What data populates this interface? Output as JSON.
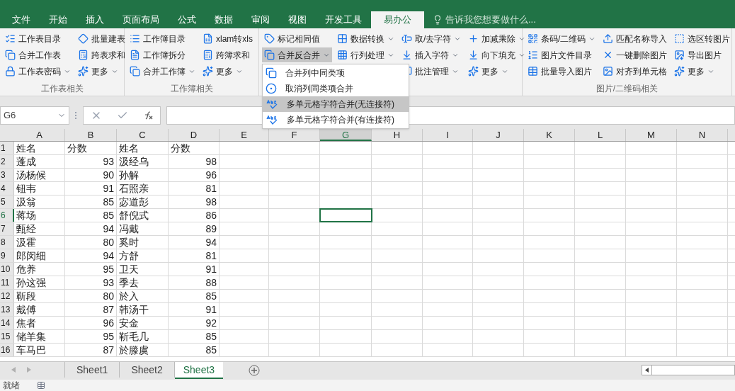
{
  "ribbon_tabs": [
    {
      "label": "文件",
      "selected": false
    },
    {
      "label": "开始",
      "selected": false
    },
    {
      "label": "插入",
      "selected": false
    },
    {
      "label": "页面布局",
      "selected": false
    },
    {
      "label": "公式",
      "selected": false
    },
    {
      "label": "数据",
      "selected": false
    },
    {
      "label": "审阅",
      "selected": false
    },
    {
      "label": "视图",
      "selected": false
    },
    {
      "label": "开发工具",
      "selected": false
    },
    {
      "label": "易办公",
      "selected": true
    }
  ],
  "tell_me": {
    "placeholder": "告诉我您想要做什么..."
  },
  "ribbon_groups": [
    {
      "label": "工作表相关",
      "columns": [
        [
          {
            "label": "工作表目录",
            "dropdown": false
          },
          {
            "label": "合并工作表",
            "dropdown": false
          },
          {
            "label": "工作表密码",
            "dropdown": true
          }
        ],
        [
          {
            "label": "批量建表",
            "dropdown": false
          },
          {
            "label": "跨表求和",
            "dropdown": false
          },
          {
            "label": "更多",
            "dropdown": true
          }
        ]
      ]
    },
    {
      "label": "工作簿相关",
      "columns": [
        [
          {
            "label": "工作簿目录",
            "dropdown": false
          },
          {
            "label": "工作簿拆分",
            "dropdown": false
          },
          {
            "label": "合并工作簿",
            "dropdown": true
          }
        ],
        [
          {
            "label": "xlam转xls",
            "dropdown": false
          },
          {
            "label": "跨簿求和",
            "dropdown": false
          },
          {
            "label": "更多",
            "dropdown": true
          }
        ]
      ]
    },
    {
      "columns": [
        [
          {
            "label": "标记相同值",
            "dropdown": false
          },
          {
            "label": "合并反合并",
            "dropdown": true,
            "pressed": true
          }
        ],
        [
          {
            "label": "数据转换",
            "dropdown": true
          },
          {
            "label": "行列处理",
            "dropdown": true
          }
        ],
        [
          {
            "label": "取/去字符",
            "dropdown": true
          },
          {
            "label": "插入字符",
            "dropdown": true
          },
          {
            "label": "批注管理",
            "dropdown": true
          }
        ],
        [
          {
            "label": "加减乘除",
            "dropdown": true
          },
          {
            "label": "向下填充",
            "dropdown": true
          },
          {
            "label": "更多",
            "dropdown": true
          }
        ]
      ]
    },
    {
      "label": "图片/二维码相关",
      "columns": [
        [
          {
            "label": "条码/二维码",
            "dropdown": true
          },
          {
            "label": "图片文件目录",
            "dropdown": false
          },
          {
            "label": "批量导入图片",
            "dropdown": false
          }
        ],
        [
          {
            "label": "匹配名称导入",
            "dropdown": false
          },
          {
            "label": "一键删除图片",
            "dropdown": false
          },
          {
            "label": "对齐到单元格",
            "dropdown": false
          }
        ],
        [
          {
            "label": "选区转图片",
            "dropdown": false
          },
          {
            "label": "导出图片",
            "dropdown": false
          },
          {
            "label": "更多",
            "dropdown": true
          }
        ]
      ]
    }
  ],
  "dropdown_menu": [
    {
      "label": "合并列中同类项",
      "selected": false
    },
    {
      "label": "取消列同类项合并",
      "selected": false
    },
    {
      "label": "多单元格字符合并(无连接符)",
      "selected": true
    },
    {
      "label": "多单元格字符合并(有连接符)",
      "selected": false
    }
  ],
  "name_box": "G6",
  "columns": [
    {
      "label": "A",
      "selected": false
    },
    {
      "label": "B",
      "selected": false
    },
    {
      "label": "C",
      "selected": false
    },
    {
      "label": "D",
      "selected": false
    },
    {
      "label": "E",
      "selected": false
    },
    {
      "label": "F",
      "selected": false
    },
    {
      "label": "G",
      "selected": true
    },
    {
      "label": "H",
      "selected": false
    },
    {
      "label": "I",
      "selected": false
    },
    {
      "label": "J",
      "selected": false
    },
    {
      "label": "K",
      "selected": false
    },
    {
      "label": "L",
      "selected": false
    },
    {
      "label": "M",
      "selected": false
    },
    {
      "label": "N",
      "selected": false
    }
  ],
  "rows": [
    {
      "number": "1",
      "selected": false,
      "cells": [
        "姓名",
        "分数",
        "姓名",
        "分数"
      ]
    },
    {
      "number": "2",
      "selected": false,
      "cells": [
        "蓬成",
        "93",
        "汲经乌",
        "98"
      ]
    },
    {
      "number": "3",
      "selected": false,
      "cells": [
        "汤杨候",
        "90",
        "孙解",
        "96"
      ]
    },
    {
      "number": "4",
      "selected": false,
      "cells": [
        "钮韦",
        "91",
        "石照亲",
        "81"
      ]
    },
    {
      "number": "5",
      "selected": false,
      "cells": [
        "汲翁",
        "85",
        "宓道彭",
        "98"
      ]
    },
    {
      "number": "6",
      "selected": true,
      "cells": [
        "蒋场",
        "85",
        "舒倪式",
        "86"
      ]
    },
    {
      "number": "7",
      "selected": false,
      "cells": [
        "甄经",
        "94",
        "冯戴",
        "89"
      ]
    },
    {
      "number": "8",
      "selected": false,
      "cells": [
        "汲霍",
        "80",
        "奚时",
        "94"
      ]
    },
    {
      "number": "9",
      "selected": false,
      "cells": [
        "郎闵细",
        "94",
        "方舒",
        "81"
      ]
    },
    {
      "number": "10",
      "selected": false,
      "cells": [
        "危养",
        "95",
        "卫天",
        "91"
      ]
    },
    {
      "number": "11",
      "selected": false,
      "cells": [
        "孙这强",
        "93",
        "季去",
        "88"
      ]
    },
    {
      "number": "12",
      "selected": false,
      "cells": [
        "靳段",
        "80",
        "於入",
        "85"
      ]
    },
    {
      "number": "13",
      "selected": false,
      "cells": [
        "戴傅",
        "87",
        "韩汤干",
        "91"
      ]
    },
    {
      "number": "14",
      "selected": false,
      "cells": [
        "焦者",
        "96",
        "安金",
        "92"
      ]
    },
    {
      "number": "15",
      "selected": false,
      "cells": [
        "储羊集",
        "95",
        "靳毛几",
        "85"
      ]
    },
    {
      "number": "16",
      "selected": false,
      "cells": [
        "车马巴",
        "87",
        "於滕虞",
        "85"
      ]
    }
  ],
  "sheet_tabs": [
    {
      "label": "Sheet1",
      "selected": false
    },
    {
      "label": "Sheet2",
      "selected": false
    },
    {
      "label": "Sheet3",
      "selected": true
    }
  ],
  "status_bar": {
    "text": "就绪"
  }
}
